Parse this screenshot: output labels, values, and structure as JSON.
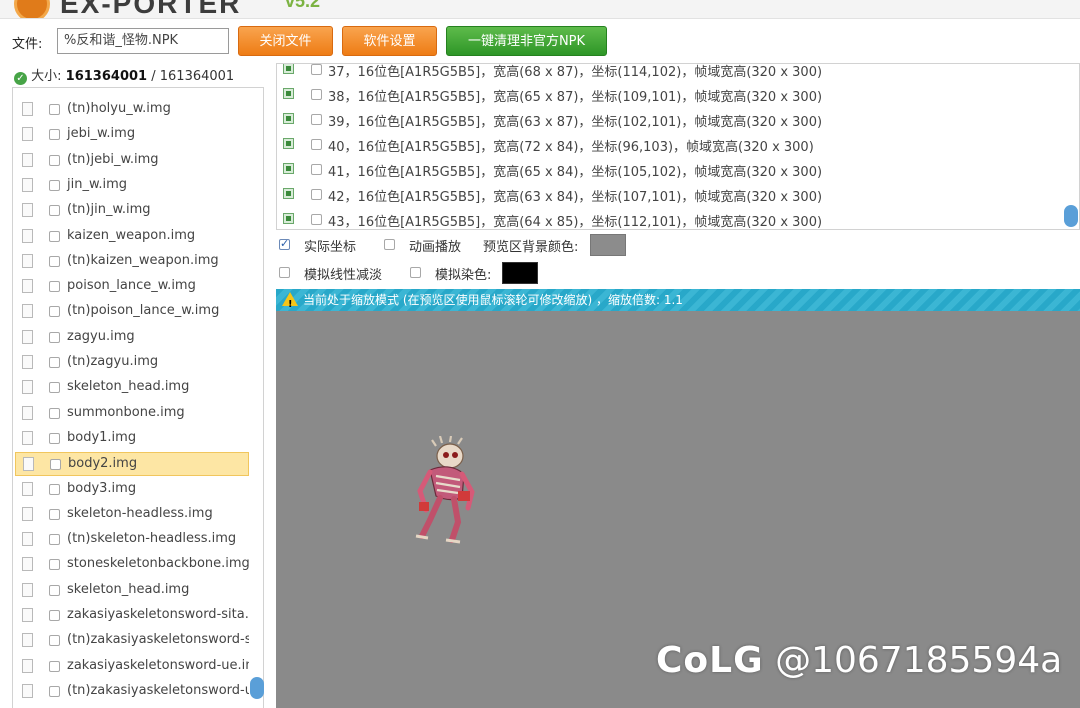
{
  "app": {
    "logo_text": "EX-PORTER",
    "version": "v5.2"
  },
  "toolbar": {
    "file_label": "文件:",
    "file_value": "%反和谐_怪物.NPK",
    "close_file": "关闭文件",
    "settings": "软件设置",
    "clean_npk": "一键清理非官方NPK"
  },
  "size": {
    "label": "大小:",
    "current": "161364001",
    "separator": "/",
    "total": "161364001"
  },
  "img_list": [
    {
      "name": "(tn)holyu_w.img",
      "selected": false
    },
    {
      "name": "jebi_w.img",
      "selected": false
    },
    {
      "name": "(tn)jebi_w.img",
      "selected": false
    },
    {
      "name": "jin_w.img",
      "selected": false
    },
    {
      "name": "(tn)jin_w.img",
      "selected": false
    },
    {
      "name": "kaizen_weapon.img",
      "selected": false
    },
    {
      "name": "(tn)kaizen_weapon.img",
      "selected": false
    },
    {
      "name": "poison_lance_w.img",
      "selected": false
    },
    {
      "name": "(tn)poison_lance_w.img",
      "selected": false
    },
    {
      "name": "zagyu.img",
      "selected": false
    },
    {
      "name": "(tn)zagyu.img",
      "selected": false
    },
    {
      "name": "skeleton_head.img",
      "selected": false
    },
    {
      "name": "summonbone.img",
      "selected": false
    },
    {
      "name": "body1.img",
      "selected": false
    },
    {
      "name": "body2.img",
      "selected": true
    },
    {
      "name": "body3.img",
      "selected": false
    },
    {
      "name": "skeleton-headless.img",
      "selected": false
    },
    {
      "name": "(tn)skeleton-headless.img",
      "selected": false
    },
    {
      "name": "stoneskeletonbackbone.img",
      "selected": false
    },
    {
      "name": "skeleton_head.img",
      "selected": false
    },
    {
      "name": "zakasiyaskeletonsword-sita.img",
      "selected": false
    },
    {
      "name": "(tn)zakasiyaskeletonsword-sita",
      "selected": false
    },
    {
      "name": "zakasiyaskeletonsword-ue.img",
      "selected": false
    },
    {
      "name": "(tn)zakasiyaskeletonsword-ue.",
      "selected": false
    }
  ],
  "frames": [
    "37，16位色[A1R5G5B5]，宽高(68 x 87)，坐标(114,102)，帧域宽高(320 x 300)",
    "38，16位色[A1R5G5B5]，宽高(65 x 87)，坐标(109,101)，帧域宽高(320 x 300)",
    "39，16位色[A1R5G5B5]，宽高(63 x 87)，坐标(102,101)，帧域宽高(320 x 300)",
    "40，16位色[A1R5G5B5]，宽高(72 x 84)，坐标(96,103)，帧域宽高(320 x 300)",
    "41，16位色[A1R5G5B5]，宽高(65 x 84)，坐标(105,102)，帧域宽高(320 x 300)",
    "42，16位色[A1R5G5B5]，宽高(63 x 84)，坐标(107,101)，帧域宽高(320 x 300)",
    "43，16位色[A1R5G5B5]，宽高(64 x 85)，坐标(112,101)，帧域宽高(320 x 300)"
  ],
  "options": {
    "actual_coords": {
      "label": "实际坐标",
      "checked": true
    },
    "animate": {
      "label": "动画播放",
      "checked": false
    },
    "bg_color_label": "预览区背景颜色:",
    "linear_fade": {
      "label": "模拟线性减淡",
      "checked": false
    },
    "tint": {
      "label": "模拟染色:",
      "checked": false
    },
    "bg_color": "#8c8c8c",
    "tint_color": "#000000"
  },
  "zoom_banner": "当前处于缩放模式 (在预览区使用鼠标滚轮可修改缩放) ，缩放倍数: 1.1",
  "watermark": {
    "logo": "CoLG",
    "handle": "@1067185594a"
  },
  "colors": {
    "orange_button": "#ee7c15",
    "green_button": "#2e9627",
    "selected_row": "#fde6a4",
    "banner": "#28a8c9",
    "preview_bg": "#8a8a8a",
    "scrollbar": "#5a9fd8"
  }
}
